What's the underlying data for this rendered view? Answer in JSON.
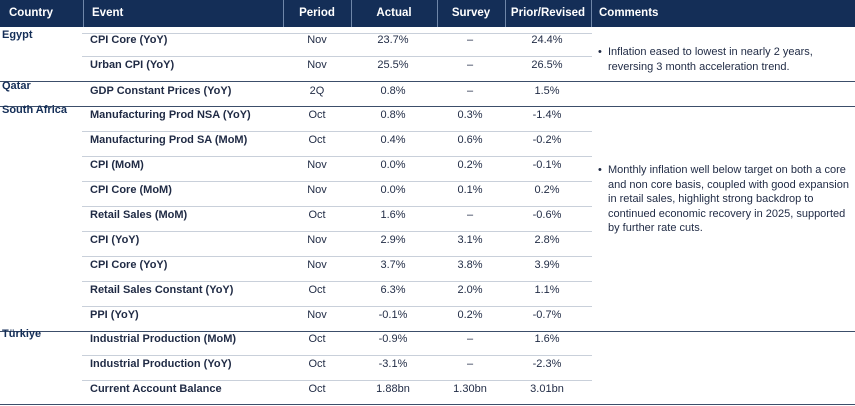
{
  "headers": {
    "country": "Country",
    "event": "Event",
    "period": "Period",
    "actual": "Actual",
    "survey": "Survey",
    "prior": "Prior/Revised",
    "comments": "Comments"
  },
  "rows": [
    {
      "country": "Egypt",
      "event": "CPI Core (YoY)",
      "period": "Nov",
      "actual": "23.7%",
      "survey": "–",
      "prior": "24.4%"
    },
    {
      "country": "",
      "event": "Urban CPI (YoY)",
      "period": "Nov",
      "actual": "25.5%",
      "survey": "–",
      "prior": "26.5%"
    },
    {
      "country": "Qatar",
      "event": "GDP Constant Prices (YoY)",
      "period": "2Q",
      "actual": "0.8%",
      "survey": "–",
      "prior": "1.5%"
    },
    {
      "country": "South Africa",
      "event": "Manufacturing Prod NSA (YoY)",
      "period": "Oct",
      "actual": "0.8%",
      "survey": "0.3%",
      "prior": "-1.4%"
    },
    {
      "country": "",
      "event": "Manufacturing Prod SA (MoM)",
      "period": "Oct",
      "actual": "0.4%",
      "survey": "0.6%",
      "prior": "-0.2%"
    },
    {
      "country": "",
      "event": "CPI (MoM)",
      "period": "Nov",
      "actual": "0.0%",
      "survey": "0.2%",
      "prior": "-0.1%"
    },
    {
      "country": "",
      "event": "CPI Core (MoM)",
      "period": "Nov",
      "actual": "0.0%",
      "survey": "0.1%",
      "prior": "0.2%"
    },
    {
      "country": "",
      "event": "Retail Sales (MoM)",
      "period": "Oct",
      "actual": "1.6%",
      "survey": "–",
      "prior": "-0.6%"
    },
    {
      "country": "",
      "event": "CPI (YoY)",
      "period": "Nov",
      "actual": "2.9%",
      "survey": "3.1%",
      "prior": "2.8%"
    },
    {
      "country": "",
      "event": "CPI Core (YoY)",
      "period": "Nov",
      "actual": "3.7%",
      "survey": "3.8%",
      "prior": "3.9%"
    },
    {
      "country": "",
      "event": "Retail Sales Constant (YoY)",
      "period": "Oct",
      "actual": "6.3%",
      "survey": "2.0%",
      "prior": "1.1%"
    },
    {
      "country": "",
      "event": "PPI (YoY)",
      "period": "Nov",
      "actual": "-0.1%",
      "survey": "0.2%",
      "prior": "-0.7%"
    },
    {
      "country": "Türkiye",
      "event": "Industrial Production (MoM)",
      "period": "Oct",
      "actual": "-0.9%",
      "survey": "–",
      "prior": "1.6%"
    },
    {
      "country": "",
      "event": "Industrial Production (YoY)",
      "period": "Oct",
      "actual": "-3.1%",
      "survey": "–",
      "prior": "-2.3%"
    },
    {
      "country": "",
      "event": "Current Account Balance",
      "period": "Oct",
      "actual": "1.88bn",
      "survey": "1.30bn",
      "prior": "3.01bn"
    }
  ],
  "comments": {
    "egypt": {
      "bullet": "•",
      "text": "Inflation eased to lowest in nearly 2 years, reversing 3 month acceleration trend."
    },
    "south_africa": {
      "bullet": "•",
      "text": "Monthly inflation well below target on both a core and non core basis, coupled with good expansion in retail sales, highlight strong backdrop to continued economic recovery in 2025, supported by further rate cuts."
    }
  },
  "colors": {
    "header_bg": "#142e57",
    "header_text": "#ffffff",
    "country_text": "#142e57",
    "row_divider": "#c9d0da",
    "group_divider": "#3c4e6a"
  }
}
